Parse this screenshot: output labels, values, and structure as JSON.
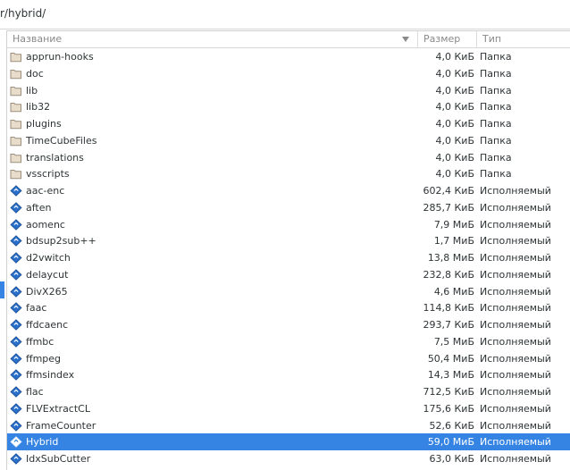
{
  "location": {
    "path": "r/hybrid/"
  },
  "columns": {
    "name": "Название",
    "size": "Размер",
    "type": "Тип"
  },
  "files": [
    {
      "name": "apprun-hooks",
      "size": "4,0 КиБ",
      "type": "Папка",
      "kind": "folder"
    },
    {
      "name": "doc",
      "size": "4,0 КиБ",
      "type": "Папка",
      "kind": "folder"
    },
    {
      "name": "lib",
      "size": "4,0 КиБ",
      "type": "Папка",
      "kind": "folder"
    },
    {
      "name": "lib32",
      "size": "4,0 КиБ",
      "type": "Папка",
      "kind": "folder"
    },
    {
      "name": "plugins",
      "size": "4,0 КиБ",
      "type": "Папка",
      "kind": "folder"
    },
    {
      "name": "TimeCubeFiles",
      "size": "4,0 КиБ",
      "type": "Папка",
      "kind": "folder"
    },
    {
      "name": "translations",
      "size": "4,0 КиБ",
      "type": "Папка",
      "kind": "folder"
    },
    {
      "name": "vsscripts",
      "size": "4,0 КиБ",
      "type": "Папка",
      "kind": "folder"
    },
    {
      "name": "aac-enc",
      "size": "602,4 КиБ",
      "type": "Исполняемый",
      "kind": "executable"
    },
    {
      "name": "aften",
      "size": "285,7 КиБ",
      "type": "Исполняемый",
      "kind": "executable"
    },
    {
      "name": "aomenc",
      "size": "7,9 МиБ",
      "type": "Исполняемый",
      "kind": "executable"
    },
    {
      "name": "bdsup2sub++",
      "size": "1,7 МиБ",
      "type": "Исполняемый",
      "kind": "executable"
    },
    {
      "name": "d2vwitch",
      "size": "13,8 МиБ",
      "type": "Исполняемый",
      "kind": "executable"
    },
    {
      "name": "delaycut",
      "size": "232,8 КиБ",
      "type": "Исполняемый",
      "kind": "executable"
    },
    {
      "name": "DivX265",
      "size": "4,6 МиБ",
      "type": "Исполняемый",
      "kind": "executable"
    },
    {
      "name": "faac",
      "size": "114,8 КиБ",
      "type": "Исполняемый",
      "kind": "executable"
    },
    {
      "name": "ffdcaenc",
      "size": "293,7 КиБ",
      "type": "Исполняемый",
      "kind": "executable"
    },
    {
      "name": "ffmbc",
      "size": "7,5 МиБ",
      "type": "Исполняемый",
      "kind": "executable"
    },
    {
      "name": "ffmpeg",
      "size": "50,4 МиБ",
      "type": "Исполняемый",
      "kind": "executable"
    },
    {
      "name": "ffmsindex",
      "size": "14,3 МиБ",
      "type": "Исполняемый",
      "kind": "executable"
    },
    {
      "name": "flac",
      "size": "712,5 КиБ",
      "type": "Исполняемый",
      "kind": "executable"
    },
    {
      "name": "FLVExtractCL",
      "size": "175,6 КиБ",
      "type": "Исполняемый",
      "kind": "executable"
    },
    {
      "name": "FrameCounter",
      "size": "52,6 КиБ",
      "type": "Исполняемый",
      "kind": "executable"
    },
    {
      "name": "Hybrid",
      "size": "59,0 МиБ",
      "type": "Исполняемый",
      "kind": "executable",
      "selected": true
    },
    {
      "name": "IdxSubCutter",
      "size": "63,0 КиБ",
      "type": "Исполняемый",
      "kind": "executable"
    }
  ],
  "colors": {
    "selection": "#3584e4",
    "folder": "#e8dccb",
    "executable": "#2a6fc9"
  },
  "icons": {
    "folder": "folder-icon",
    "executable": "executable-icon",
    "sort": "sort-descending-icon"
  }
}
